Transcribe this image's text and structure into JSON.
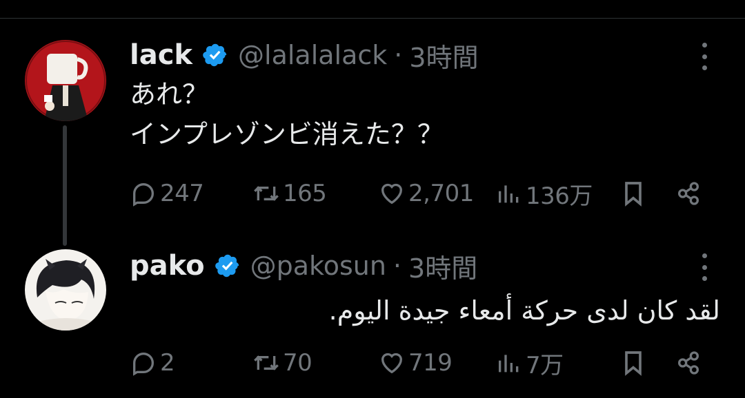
{
  "tweets": [
    {
      "name": "lack",
      "handle": "@lalalalack",
      "separator": "·",
      "time": "3時間",
      "text_lines": [
        "あれ？",
        "インプレゾンビ消えた？？"
      ],
      "stats": {
        "replies": "247",
        "retweets": "165",
        "likes": "2,701",
        "views": "136万"
      }
    },
    {
      "name": "pako",
      "handle": "@pakosun",
      "separator": "·",
      "time": "3時間",
      "text": "لقد كان لدى حركة أمعاء جيدة اليوم.",
      "stats": {
        "replies": "2",
        "retweets": "70",
        "likes": "719",
        "views": "7万"
      }
    }
  ],
  "colors": {
    "background": "#000000",
    "text": "#e7e9ea",
    "muted": "#71767b",
    "verified": "#1d9bf0"
  },
  "icons": [
    "verified-badge-icon",
    "more-options-icon",
    "reply-icon",
    "retweet-icon",
    "like-icon",
    "views-icon",
    "bookmark-icon",
    "share-icon"
  ]
}
